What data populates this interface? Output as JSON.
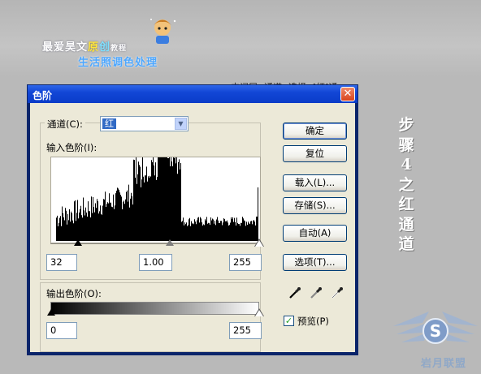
{
  "banner": {
    "line1_a": "最爱昊文",
    "line1_b": "原",
    "line1_c": "创",
    "line1_d": "教程",
    "line2": "生活照调色处理"
  },
  "background_text": "中间层--通道--选择--[红]通",
  "side_title": [
    "步",
    "骤",
    "4",
    "之",
    "红",
    "通",
    "道"
  ],
  "watermark": {
    "text": "岩月联盟",
    "icon": "winged-s-logo"
  },
  "dialog": {
    "title": "色阶",
    "close_symbol": "✕",
    "channel_label": "通道(C):",
    "channel_value": "红",
    "input_levels_label": "输入色阶(I):",
    "input_levels": {
      "black": "32",
      "gamma": "1.00",
      "white": "255"
    },
    "output_levels_label": "输出色阶(O):",
    "output_levels": {
      "black": "0",
      "white": "255"
    },
    "buttons": {
      "ok": "确定",
      "reset": "复位",
      "load": "载入(L)...",
      "save": "存储(S)...",
      "auto": "自动(A)",
      "options": "选项(T)..."
    },
    "preview_label": "预览(P)",
    "preview_checked": true,
    "eyedroppers": [
      "black-eyedropper-icon",
      "gray-eyedropper-icon",
      "white-eyedropper-icon"
    ]
  },
  "colors": {
    "title_bar": "#0a3cc8",
    "dialog_face": "#ece9d8",
    "accent": "#316ac5"
  }
}
